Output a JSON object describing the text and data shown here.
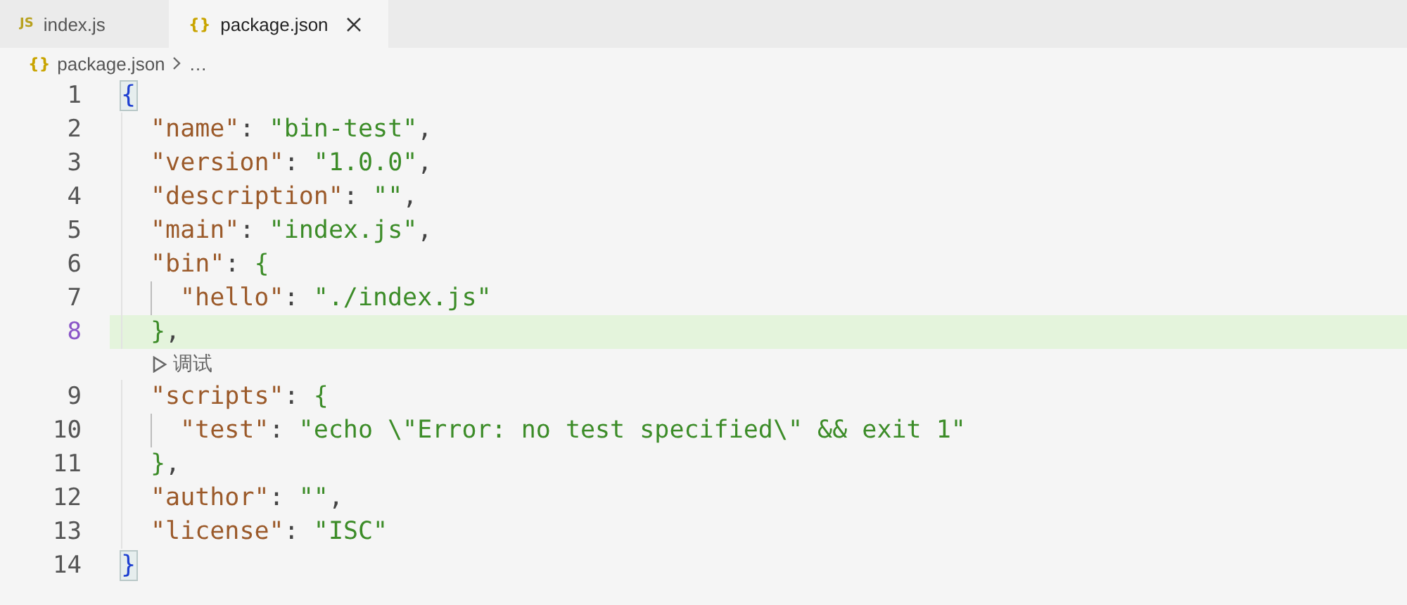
{
  "tabs": [
    {
      "label": "index.js",
      "icon": "JS",
      "selected": false
    },
    {
      "label": "package.json",
      "icon": "{}",
      "selected": true
    }
  ],
  "breadcrumb": {
    "icon": "{}",
    "file": "package.json",
    "rest": "…"
  },
  "editor": {
    "lines": [
      {
        "number": "1",
        "current": false,
        "tokens": [
          {
            "kind": "bracket-match",
            "text": "{"
          }
        ]
      },
      {
        "kind": "block",
        "children": [
          {
            "number": "2",
            "current": false,
            "tokens": [
              {
                "kind": "key",
                "text": "\"name\""
              },
              {
                "kind": "punct",
                "text": ": "
              },
              {
                "kind": "string",
                "text": "\"bin-test\""
              },
              {
                "kind": "punct",
                "text": ","
              }
            ]
          },
          {
            "number": "3",
            "current": false,
            "tokens": [
              {
                "kind": "key",
                "text": "\"version\""
              },
              {
                "kind": "punct",
                "text": ": "
              },
              {
                "kind": "string",
                "text": "\"1.0.0\""
              },
              {
                "kind": "punct",
                "text": ","
              }
            ]
          },
          {
            "number": "4",
            "current": false,
            "tokens": [
              {
                "kind": "key",
                "text": "\"description\""
              },
              {
                "kind": "punct",
                "text": ": "
              },
              {
                "kind": "string",
                "text": "\"\""
              },
              {
                "kind": "punct",
                "text": ","
              }
            ]
          },
          {
            "number": "5",
            "current": false,
            "tokens": [
              {
                "kind": "key",
                "text": "\"main\""
              },
              {
                "kind": "punct",
                "text": ": "
              },
              {
                "kind": "string",
                "text": "\"index.js\""
              },
              {
                "kind": "punct",
                "text": ","
              }
            ]
          },
          {
            "number": "6",
            "current": false,
            "tokens": [
              {
                "kind": "key",
                "text": "\"bin\""
              },
              {
                "kind": "punct",
                "text": ": "
              },
              {
                "kind": "brace",
                "text": "{"
              }
            ]
          },
          {
            "kind": "block",
            "children": [
              {
                "number": "7",
                "current": false,
                "tokens": [
                  {
                    "kind": "key",
                    "text": "\"hello\""
                  },
                  {
                    "kind": "punct",
                    "text": ": "
                  },
                  {
                    "kind": "string",
                    "text": "\"./index.js\""
                  }
                ]
              }
            ]
          },
          {
            "number": "8",
            "current": true,
            "tokens": [
              {
                "kind": "brace",
                "text": "}"
              },
              {
                "kind": "punct",
                "text": ","
              }
            ]
          },
          {
            "kind": "codelens",
            "label": "调试"
          },
          {
            "number": "9",
            "current": false,
            "tokens": [
              {
                "kind": "key",
                "text": "\"scripts\""
              },
              {
                "kind": "punct",
                "text": ": "
              },
              {
                "kind": "brace",
                "text": "{"
              }
            ]
          },
          {
            "kind": "block",
            "children": [
              {
                "number": "10",
                "current": false,
                "tokens": [
                  {
                    "kind": "key",
                    "text": "\"test\""
                  },
                  {
                    "kind": "punct",
                    "text": ": "
                  },
                  {
                    "kind": "string",
                    "text": "\"echo \\\"Error: no test specified\\\" && exit 1\""
                  }
                ]
              }
            ]
          },
          {
            "number": "11",
            "current": false,
            "tokens": [
              {
                "kind": "brace",
                "text": "}"
              },
              {
                "kind": "punct",
                "text": ","
              }
            ]
          },
          {
            "number": "12",
            "current": false,
            "tokens": [
              {
                "kind": "key",
                "text": "\"author\""
              },
              {
                "kind": "punct",
                "text": ": "
              },
              {
                "kind": "string",
                "text": "\"\""
              },
              {
                "kind": "punct",
                "text": ","
              }
            ]
          },
          {
            "number": "13",
            "current": false,
            "tokens": [
              {
                "kind": "key",
                "text": "\"license\""
              },
              {
                "kind": "punct",
                "text": ": "
              },
              {
                "kind": "string",
                "text": "\"ISC\""
              }
            ]
          }
        ]
      },
      {
        "number": "14",
        "current": false,
        "tokens": [
          {
            "kind": "bracket-match",
            "text": "}"
          }
        ]
      }
    ]
  }
}
